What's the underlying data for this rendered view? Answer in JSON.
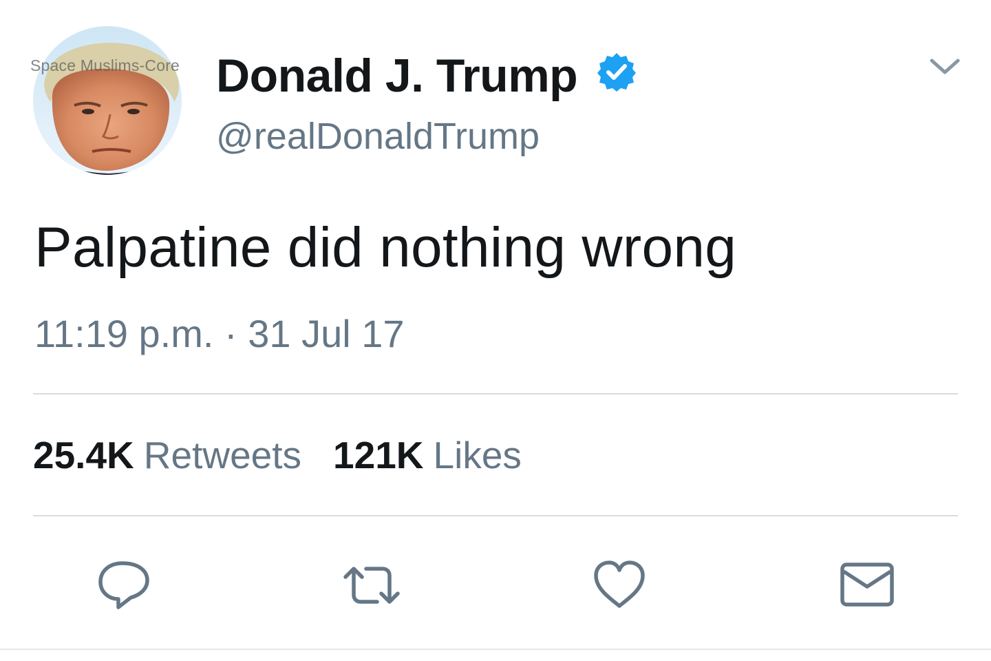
{
  "watermark": "Space Muslims-Core",
  "author": {
    "display_name": "Donald J. Trump",
    "handle": "@realDonaldTrump",
    "verified": true,
    "verified_color": "#1da1f2",
    "avatar_icon": "profile-photo"
  },
  "menu_icon": "chevron-down-icon",
  "tweet": {
    "text": "Palpatine did nothing wrong",
    "timestamp": "11:19 p.m. · 31 Jul 17"
  },
  "stats": {
    "retweets_count": "25.4K",
    "retweets_label": "Retweets",
    "likes_count": "121K",
    "likes_label": "Likes"
  },
  "actions": [
    {
      "name": "reply",
      "icon": "speech-bubble-icon"
    },
    {
      "name": "retweet",
      "icon": "retweet-arrows-icon"
    },
    {
      "name": "like",
      "icon": "heart-icon"
    },
    {
      "name": "direct-message",
      "icon": "envelope-icon"
    }
  ],
  "colors": {
    "text": "#14171a",
    "secondary": "#657786",
    "divider": "#d5dde3",
    "icon": "#657786"
  }
}
